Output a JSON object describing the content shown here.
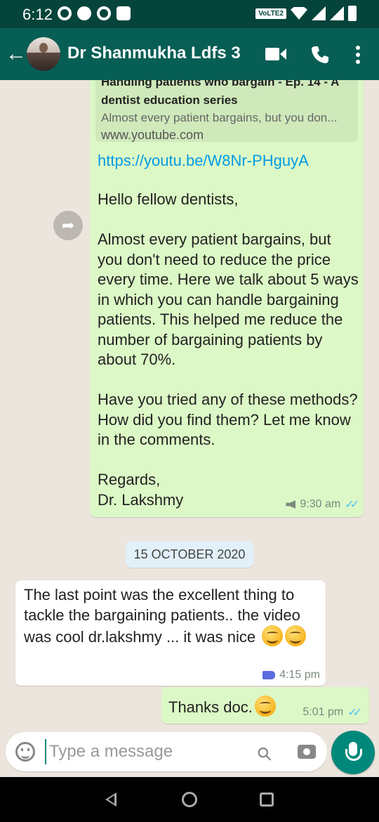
{
  "status_bar": {
    "time": "6:12",
    "network_badge": "VoLTE2"
  },
  "header": {
    "contact_name": "Dr Shanmukha Ldfs 3"
  },
  "messages": {
    "video_message": {
      "preview_title": "Handling patients who bargain - Ep. 14 - A dentist education series",
      "preview_description": "Almost every patient bargains, but you don...",
      "preview_site": "www.youtube.com",
      "link": "https://youtu.be/W8Nr-PHguyA",
      "para1": "Hello fellow dentists,",
      "para2": "Almost every patient bargains, but you don't need to reduce the price every time. Here we talk about 5 ways in which you can handle bargaining patients. This helped me reduce the number of bargaining patients by about 70%.",
      "para3": "Have you tried any of these methods? How did you find them? Let me know in the comments.",
      "para4": "Regards,\nDr. Lakshmy",
      "time": "9:30 am"
    },
    "date_divider": "15 OCTOBER 2020",
    "incoming_reply": {
      "text": "The last point was the excellent thing to tackle the bargaining patients.. the video was cool dr.lakshmy ... it was nice",
      "time": "4:15 pm"
    },
    "outgoing_reply": {
      "text": "Thanks doc.",
      "time": "5:01 pm"
    }
  },
  "composer": {
    "placeholder": "Type a message"
  }
}
